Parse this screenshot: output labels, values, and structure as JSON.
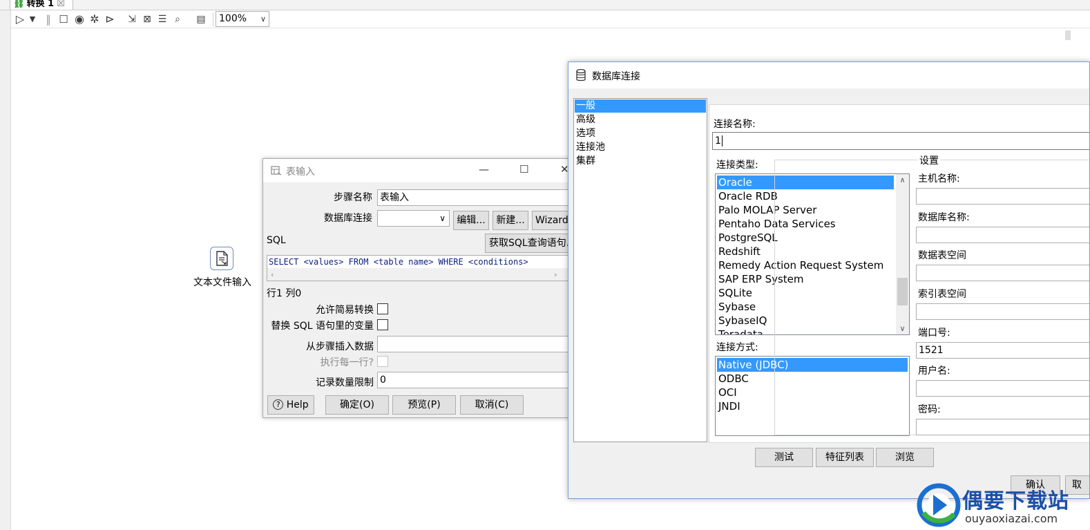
{
  "tab": {
    "title": "转换 1",
    "close": "☒"
  },
  "toolbar": {
    "zoom": "100%"
  },
  "canvas": {
    "step_label": "文本文件输入"
  },
  "table_input": {
    "title": "表输入",
    "labels": {
      "step_name": "步骤名称",
      "db_connection": "数据库连接",
      "sql": "SQL",
      "allow_lazy": "允许简易转换",
      "replace_vars": "替换 SQL 语句里的变量",
      "insert_from_step": "从步骤插入数据",
      "execute_each_row": "执行每一行?",
      "limit": "记录数量限制"
    },
    "values": {
      "step_name": "表输入",
      "db_connection": "",
      "sql": "SELECT <values> FROM <table name> WHERE <conditions>",
      "row_col": "行1 列0",
      "insert_from_step": "",
      "limit": "0"
    },
    "buttons": {
      "edit": "编辑...",
      "new": "新建...",
      "wizard": "Wizard...",
      "get_sql": "获取SQL查询语句...",
      "help": "Help",
      "ok": "确定(O)",
      "preview": "预览(P)",
      "cancel": "取消(C)"
    }
  },
  "db_dialog": {
    "title": "数据库连接",
    "nav": [
      "一般",
      "高级",
      "选项",
      "连接池",
      "集群"
    ],
    "labels": {
      "conn_name": "连接名称:",
      "conn_type": "连接类型:",
      "access": "连接方式:",
      "settings": "设置",
      "host": "主机名称:",
      "db_name": "数据库名称:",
      "data_tablespace": "数据表空间",
      "index_tablespace": "索引表空间",
      "port": "端口号:",
      "username": "用户名:",
      "password": "密码:"
    },
    "values": {
      "conn_name": "1",
      "host": "",
      "db_name": "",
      "data_tablespace": "",
      "index_tablespace": "",
      "port": "1521",
      "username": "",
      "password": ""
    },
    "conn_types": [
      "Oracle",
      "Oracle RDB",
      "Palo MOLAP Server",
      "Pentaho Data Services",
      "PostgreSQL",
      "Redshift",
      "Remedy Action Request System",
      "SAP ERP System",
      "SQLite",
      "Sybase",
      "SybaseIQ",
      "Teradata"
    ],
    "selected_type": "Oracle",
    "access_methods": [
      "Native (JDBC)",
      "ODBC",
      "OCI",
      "JNDI"
    ],
    "selected_access": "Native (JDBC)",
    "buttons": {
      "test": "测试",
      "features": "特征列表",
      "explore": "浏览",
      "ok": "确认",
      "cancel": "取"
    }
  },
  "watermark": {
    "cn": "偶要下载站",
    "en": "ouyaoxiazai.com"
  }
}
